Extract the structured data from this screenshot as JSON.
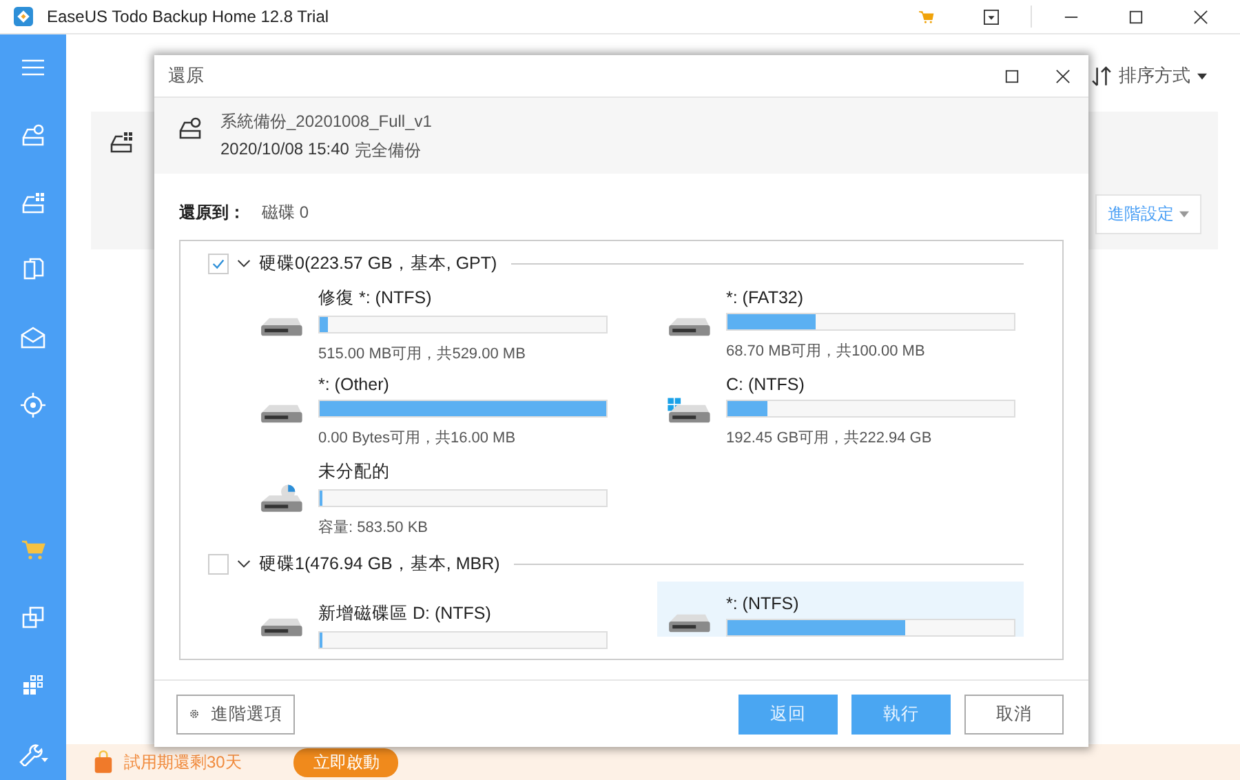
{
  "window": {
    "title": "EaseUS Todo Backup Home 12.8 Trial"
  },
  "sort_button": {
    "label": "排序方式"
  },
  "backup_card": {
    "advanced_settings": "進階設定"
  },
  "promo": {
    "text": "試用期還剩30天",
    "button": "立即啟動"
  },
  "dialog": {
    "title": "還原",
    "backup_name": "系統備份_20201008_Full_v1",
    "backup_date": "2020/10/08 15:40",
    "backup_type": "完全備份",
    "restore_to_label": "還原到：",
    "restore_to_value": "磁碟 0",
    "disks": [
      {
        "label": "硬碟0(223.57 GB，基本, GPT)",
        "checked": true,
        "expanded": true,
        "partitions": [
          {
            "kind": "disk",
            "name": "修復 *: (NTFS)",
            "level": 0.03,
            "capacity": "515.00 MB可用，共529.00 MB",
            "selected": false
          },
          {
            "kind": "disk",
            "name": "*: (FAT32)",
            "level": 0.31,
            "capacity": "68.70 MB可用，共100.00 MB",
            "selected": false
          },
          {
            "kind": "disk",
            "name": "*: (Other)",
            "level": 1,
            "capacity": "0.00 Bytes可用，共16.00 MB",
            "selected": false
          },
          {
            "kind": "windows",
            "name": "C: (NTFS)",
            "level": 0.14,
            "capacity": "192.45 GB可用，共222.94 GB",
            "selected": false
          },
          {
            "kind": "unallocated",
            "name": "未分配的",
            "level": 0,
            "capacity": "容量: 583.50 KB",
            "selected": false
          }
        ]
      },
      {
        "label": "硬碟1(476.94 GB，基本, MBR)",
        "checked": false,
        "expanded": true,
        "partitions": [
          {
            "kind": "disk",
            "name": "新增磁碟區 D: (NTFS)",
            "level": 0.01,
            "selected": false
          },
          {
            "kind": "disk",
            "name": "*: (NTFS)",
            "level": 0.62,
            "selected": true
          }
        ]
      }
    ],
    "buttons": {
      "advanced_options": "進階選項",
      "back": "返回",
      "execute": "執行",
      "cancel": "取消"
    }
  }
}
